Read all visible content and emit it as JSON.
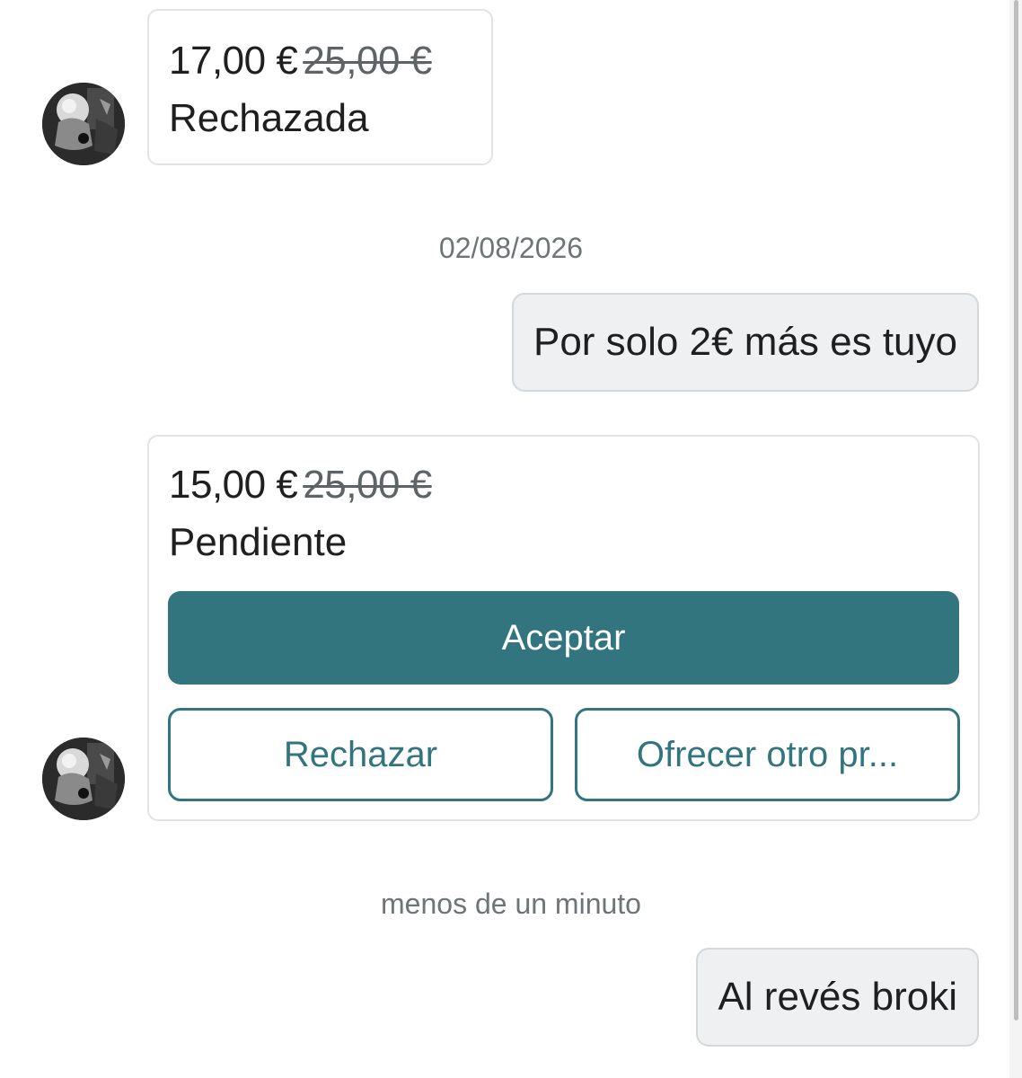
{
  "messages": {
    "offer_rejected": {
      "price": "17,00 €",
      "original_price": "25,00 €",
      "status": "Rechazada"
    },
    "date_separator_1": "02/08/2026",
    "outgoing_1": "Por solo 2€ más es tuyo",
    "offer_pending": {
      "price": "15,00 €",
      "original_price": "25,00 €",
      "status": "Pendiente",
      "accept_label": "Aceptar",
      "reject_label": "Rechazar",
      "counter_label": "Ofrecer otro pr..."
    },
    "date_separator_2": "menos de un minuto",
    "outgoing_2": "Al revés broki"
  },
  "theme": {
    "accent": "#33757f",
    "bubble_out_bg": "#eef0f1",
    "border": "#e2e4e4"
  }
}
